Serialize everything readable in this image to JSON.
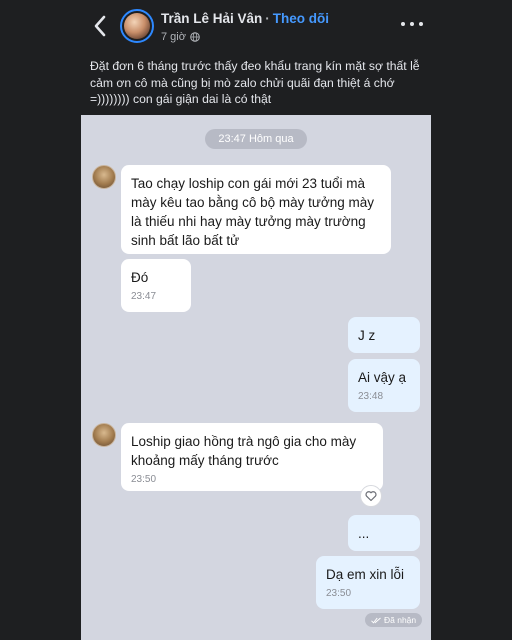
{
  "post": {
    "author": "Trần Lê Hải Vân",
    "separator": "·",
    "follow_label": "Theo dõi",
    "time": "7 giờ",
    "audience_icon": "globe-icon",
    "caption": "Đặt đơn 6 tháng trước thấy đeo khẩu trang kín mặt sợ thất lễ cảm ơn cô mà cũng bị mò zalo chửi quãi đạn thiệt á chớ =)))))))) con gái giận dai là có thật"
  },
  "chat": {
    "date_label": "23:47 Hôm qua",
    "messages": [
      {
        "dir": "in",
        "text": "Tao chạy loship con gái mới 23 tuổi mà mày kêu tao bằng cô bộ mày tưởng mày là thiếu nhi hay mày tưởng mày trường sinh bất lão bất tử",
        "time": ""
      },
      {
        "dir": "in",
        "text": "Đó",
        "time": "23:47"
      },
      {
        "dir": "out",
        "text": "J z",
        "time": ""
      },
      {
        "dir": "out",
        "text": "Ai vậy ạ",
        "time": "23:48"
      },
      {
        "dir": "in",
        "text": "Loship giao hồng trà ngô gia cho mày khoảng mấy tháng trước",
        "time": "23:50"
      },
      {
        "dir": "out",
        "text": "...",
        "time": ""
      },
      {
        "dir": "out",
        "text": "Dạ em xin lỗi",
        "time": "23:50"
      }
    ],
    "status": "Đã nhận"
  },
  "icons": [
    "back-arrow-icon",
    "globe-icon",
    "more-options-icon",
    "heart-icon",
    "double-check-icon"
  ],
  "colors": {
    "background": "#1e1f21",
    "follow": "#4599ff",
    "chat_bg": "#d3d6e0",
    "bubble_out": "#e5f2ff",
    "bubble_in": "#ffffff"
  }
}
